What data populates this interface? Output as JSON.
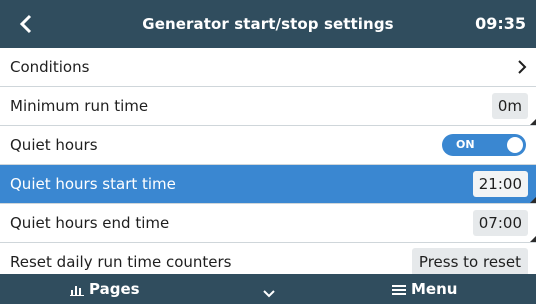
{
  "header": {
    "title": "Generator start/stop settings",
    "time": "09:35",
    "back_icon": "chevron-left-icon"
  },
  "rows": [
    {
      "label": "Conditions",
      "control": "chevron-right-icon"
    },
    {
      "label": "Minimum run time",
      "value": "0m"
    },
    {
      "label": "Quiet hours",
      "toggle_text": "ON",
      "toggle_state": true
    },
    {
      "label": "Quiet hours start time",
      "value": "21:00",
      "selected": true
    },
    {
      "label": "Quiet hours end time",
      "value": "07:00"
    },
    {
      "label": "Reset daily run time counters",
      "button": "Press to reset"
    }
  ],
  "footer": {
    "pages_label": "Pages",
    "pages_icon": "chart-icon",
    "center_icon": "chevron-down-icon",
    "menu_label": "Menu",
    "menu_icon": "hamburger-icon"
  },
  "colors": {
    "header": "#304d5e",
    "selected_row": "#3a87d1",
    "toggle_on": "#3a87d1",
    "value_box": "#e6e9eb"
  }
}
